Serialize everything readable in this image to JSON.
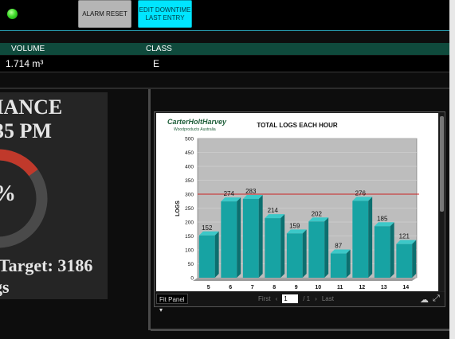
{
  "toolbar": {
    "alarm_reset": "ALARM RESET",
    "edit_downtime": "EDIT DOWNTIME\nLAST ENTRY"
  },
  "table": {
    "headers": {
      "volume": "VOLUME",
      "class": "CLASS"
    },
    "row": {
      "volume": "1.714 m³",
      "class": "E"
    }
  },
  "performance": {
    "line1": "MANCE",
    "line2": "35 PM",
    "percent": "%",
    "target": "Target: 3186",
    "logs": "gs",
    "colors": {
      "ring": "#4a4a4a",
      "arc": "#c0392b"
    }
  },
  "chart_panel": {
    "logo_line1": "CarterHoltHarvey",
    "logo_line2": "Woodproducts Australia",
    "fit_panel": "Fit Panel",
    "first": "First",
    "page": "1",
    "of_pages": "/ 1",
    "last": "Last"
  },
  "chart_data": {
    "type": "bar",
    "title": "TOTAL LOGS EACH HOUR",
    "ylabel": "LOGS",
    "xlabel": "",
    "categories": [
      "5",
      "6",
      "7",
      "8",
      "9",
      "10",
      "11",
      "12",
      "13",
      "14"
    ],
    "values": [
      152,
      274,
      283,
      214,
      159,
      202,
      87,
      276,
      185,
      121
    ],
    "ylim": [
      0,
      500
    ],
    "yticks": [
      0,
      50,
      100,
      150,
      200,
      250,
      300,
      350,
      400,
      450,
      500
    ],
    "target_line": 300,
    "bar_color": "#17a3a3",
    "target_color": "#cc2222",
    "grid": true
  }
}
